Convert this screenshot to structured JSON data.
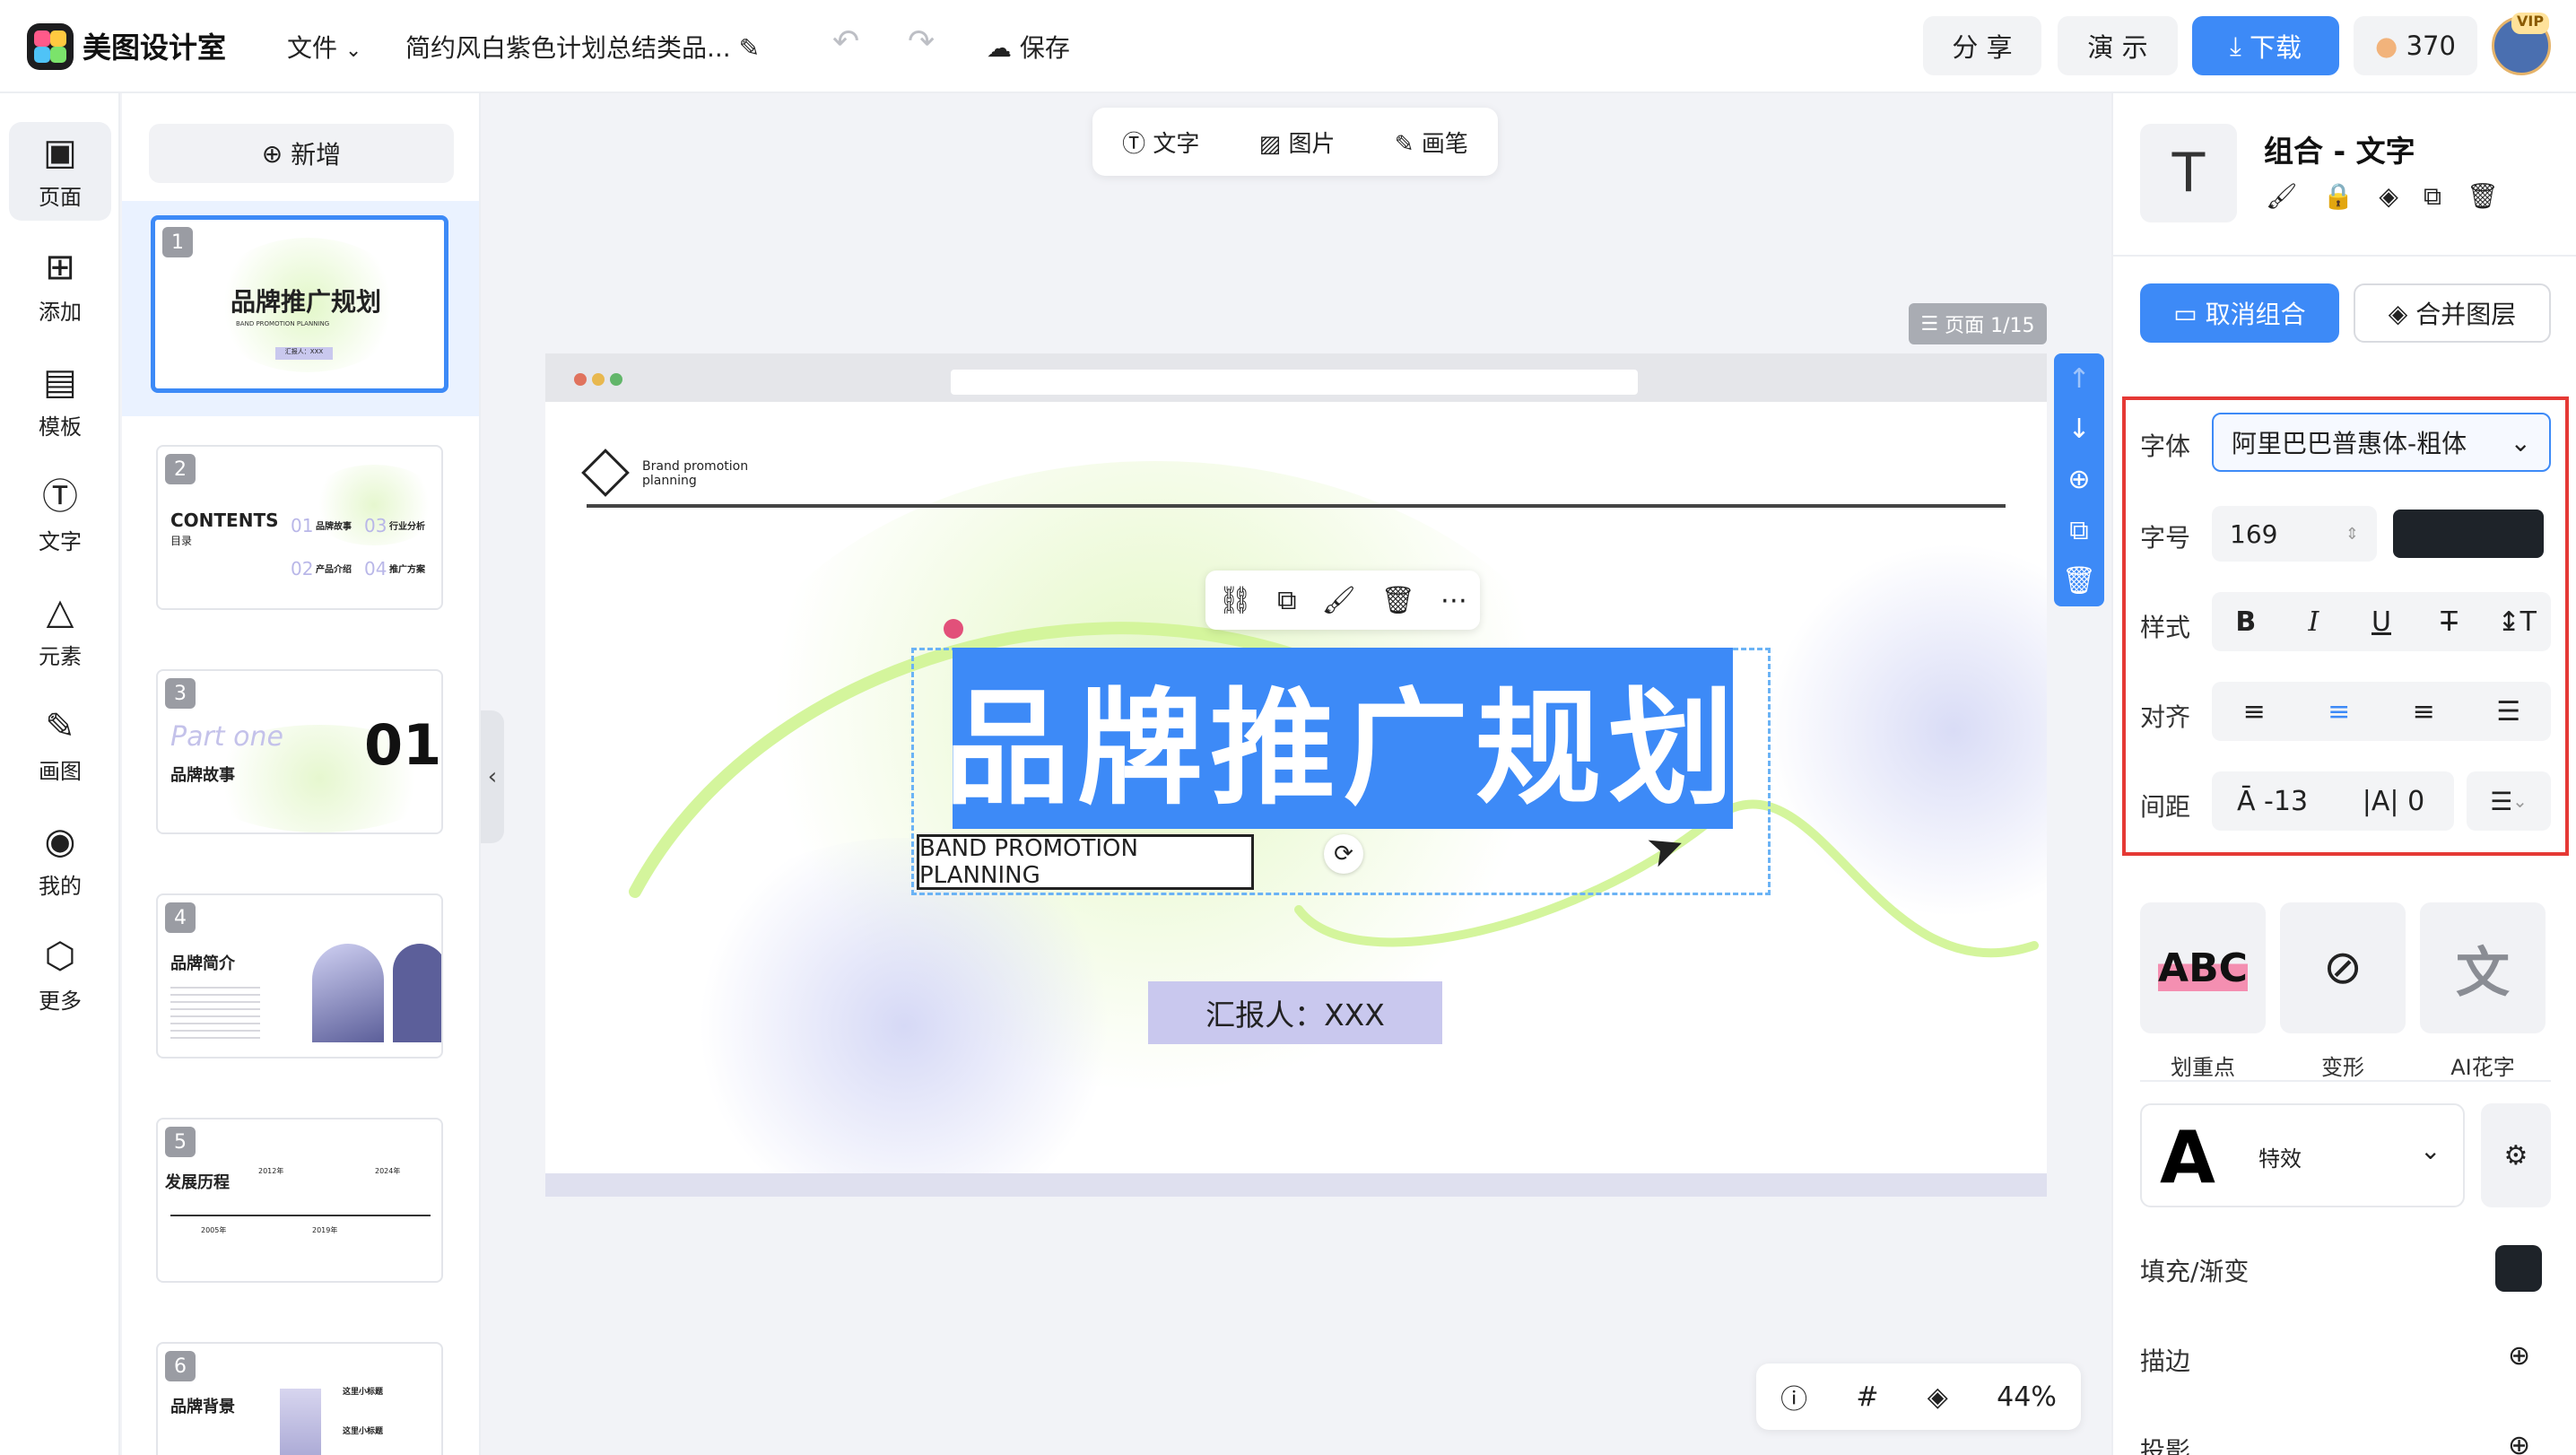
{
  "app": {
    "name": "美图设计室"
  },
  "header": {
    "file_menu": "文件",
    "doc_title": "简约风白紫色计划总结类品...",
    "save_label": "保存",
    "share_label": "分 享",
    "present_label": "演 示",
    "download_label": "下载",
    "credits": "370",
    "vip_badge": "VIP"
  },
  "rail": {
    "items": [
      {
        "label": "页面",
        "icon": "page-icon"
      },
      {
        "label": "添加",
        "icon": "plus-square-icon"
      },
      {
        "label": "模板",
        "icon": "template-icon"
      },
      {
        "label": "文字",
        "icon": "text-icon"
      },
      {
        "label": "元素",
        "icon": "shapes-icon"
      },
      {
        "label": "画图",
        "icon": "draw-icon"
      },
      {
        "label": "我的",
        "icon": "user-icon"
      },
      {
        "label": "更多",
        "icon": "box-icon"
      }
    ]
  },
  "pages_panel": {
    "add_label": "新增",
    "thumbs": [
      {
        "num": "1",
        "title": "品牌推广规划",
        "sub": "BAND PROMOTION PLANNING",
        "reporter": "汇报人：XXX"
      },
      {
        "num": "2",
        "title": "CONTENTS",
        "sub": "目录",
        "items": [
          "品牌故事",
          "行业分析",
          "产品介绍",
          "推广方案"
        ],
        "nums": [
          "01",
          "03",
          "02",
          "04"
        ]
      },
      {
        "num": "3",
        "title": "品牌故事",
        "part": "Part one",
        "big": "01"
      },
      {
        "num": "4",
        "title": "品牌简介"
      },
      {
        "num": "5",
        "title": "发展历程",
        "years": [
          "2012年",
          "2024年",
          "2005年",
          "2019年"
        ]
      },
      {
        "num": "6",
        "title": "品牌背景",
        "items": [
          "这里小标题",
          "这里小标题"
        ]
      }
    ]
  },
  "canvas_toolbar": {
    "text": "文字",
    "image": "图片",
    "pen": "画笔"
  },
  "page_indicator": "页面 1/15",
  "slide": {
    "brand_line1": "Brand promotion",
    "brand_line2": "planning",
    "headline": "品牌推广规划",
    "subtitle": "BAND PROMOTION PLANNING",
    "reporter": "汇报人：XXX"
  },
  "zoom": "44%",
  "props": {
    "title": "组合 - 文字",
    "ungroup": "取消组合",
    "merge": "合并图层",
    "font_label": "字体",
    "font_value": "阿里巴巴普惠体-粗体",
    "size_label": "字号",
    "size_value": "169",
    "color": "#1e2329",
    "style_label": "样式",
    "align_label": "对齐",
    "spacing_label": "间距",
    "letter_spacing": "-13",
    "line_spacing": "0",
    "cards": [
      {
        "label": "划重点",
        "preview": "ABC"
      },
      {
        "label": "变形"
      },
      {
        "label": "AI花字",
        "preview": "文"
      }
    ],
    "effect_label": "特效",
    "effect_preview": "A",
    "fill_label": "填充/渐变",
    "stroke_label": "描边",
    "shadow_label": "投影"
  },
  "colors": {
    "accent": "#3d8af7",
    "highlight_box": "#e53935",
    "reporter_bg": "#c9c8ee"
  }
}
